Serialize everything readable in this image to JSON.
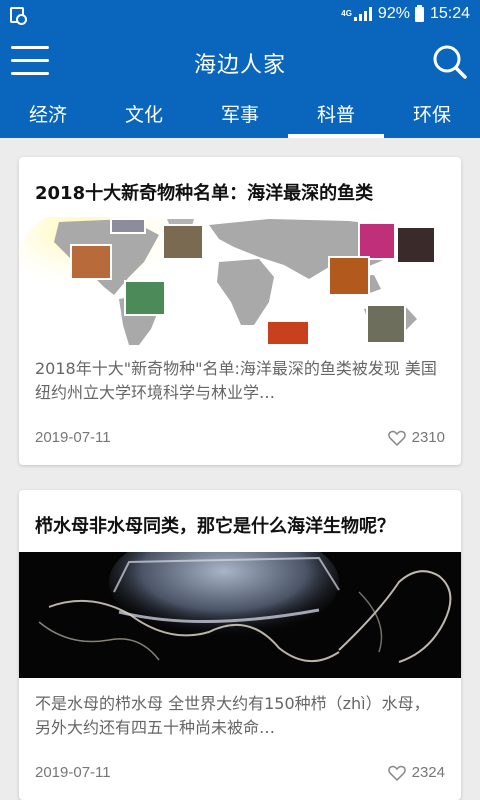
{
  "status": {
    "network": "4G",
    "battery": "92%",
    "time": "15:24"
  },
  "app": {
    "title": "海边人家"
  },
  "tabs": [
    {
      "label": "经济"
    },
    {
      "label": "文化"
    },
    {
      "label": "军事"
    },
    {
      "label": "科普",
      "active": true
    },
    {
      "label": "环保"
    }
  ],
  "articles": [
    {
      "title": "2018十大新奇物种名单：海洋最深的鱼类",
      "summary": "  2018年十大\"新奇物种\"名单:海洋最深的鱼类被发现  美国纽约州立大学环境科学与林业学…",
      "date": "2019-07-11",
      "likes": "2310",
      "image": "world-map-with-species-photos"
    },
    {
      "title": "栉水母非水母同类，那它是什么海洋生物呢？",
      "summary": "  不是水母的栉水母    全世界大约有150种栉（zhì）水母，另外大约还有四五十种尚未被命…",
      "date": "2019-07-11",
      "likes": "2324",
      "image": "comb-jelly-photo"
    }
  ],
  "colors": {
    "brand": "#0a66bd",
    "background": "#ececec",
    "text_muted": "#777777"
  }
}
